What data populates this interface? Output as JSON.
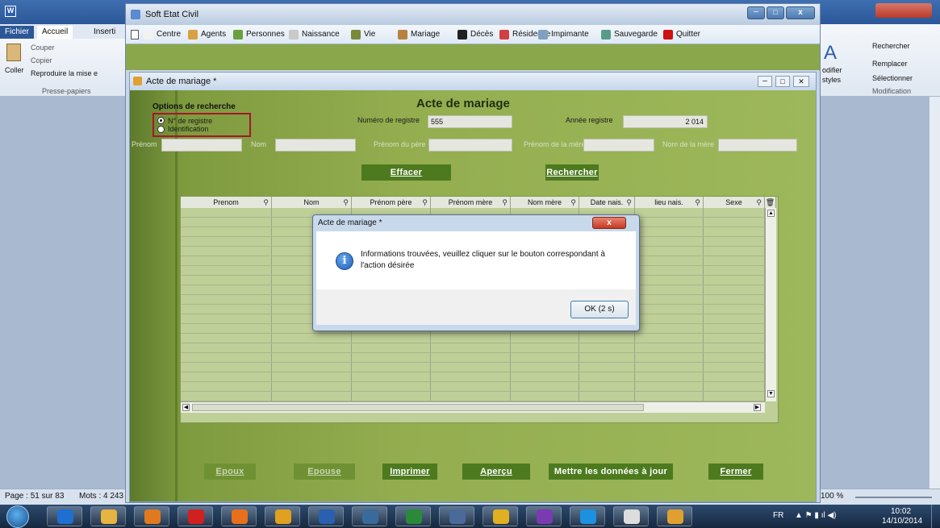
{
  "word": {
    "tabs": [
      "Fichier",
      "Accueil",
      "Inserti"
    ],
    "ribbon_left": {
      "couper": "Couper",
      "copier": "Copier",
      "coller": "Coller",
      "reproduire": "Reproduire la mise e",
      "group": "Presse-papiers"
    },
    "ribbon_right": {
      "modifier": "odifier",
      "styles": "styles",
      "rechercher": "Rechercher",
      "remplacer": "Remplacer",
      "selectionner": "Sélectionner",
      "group": "Modification"
    },
    "status": {
      "page": "Page : 51 sur 83",
      "mots": "Mots : 4 243",
      "zoom": "100 %"
    }
  },
  "app": {
    "title": "Soft Etat Civil",
    "menu": [
      "Centre",
      "Agents",
      "Personnes",
      "Naissance",
      "Vie",
      "Mariage",
      "Décès",
      "Résidence",
      "Impimante",
      "Sauvegarde",
      "Quitter"
    ],
    "menu_colors": [
      "#f2f2f2",
      "#d8a040",
      "#6aa03a",
      "#c9c9c9",
      "#7a8a3a",
      "#b8823e",
      "#222222",
      "#d04040",
      "#7fa0c0",
      "#5a9a8a",
      "#d01010"
    ]
  },
  "child": {
    "title": "Acte de mariage *",
    "form_title": "Acte de mariage",
    "options": {
      "title": "Options de recherche",
      "opt1": "N° de registre",
      "opt2": "Identification"
    },
    "num_registre": {
      "label": "Numéro de registre",
      "value": "555"
    },
    "annee": {
      "label": "Année registre",
      "value": "2 014"
    },
    "filters": {
      "prenom": "Prénom",
      "nom": "Nom",
      "pere": "Prénom du père",
      "mere": "Prénom de la mère",
      "nom_mere": "Nom de la mère"
    },
    "btn_effacer": "Effacer",
    "btn_rechercher": "Rechercher",
    "columns": [
      "Prenom",
      "Nom",
      "Prénom père",
      "Prénom mère",
      "Nom mère",
      "Date nais.",
      "lieu nais.",
      "Sexe"
    ],
    "bottom_buttons": [
      "Epoux",
      "Epouse",
      "Imprimer",
      "Aperçu",
      "Mettre les données à jour",
      "Fermer"
    ]
  },
  "dialog": {
    "title": "Acte de mariage *",
    "message": "Informations trouvées, veuillez cliquer sur le bouton correspondant à l'action désirée",
    "ok": "OK (2 s)",
    "close": "x"
  },
  "taskbar": {
    "lang": "FR",
    "time": "10:02",
    "date": "14/10/2014",
    "apps": [
      "ie",
      "explorer",
      "media",
      "opera",
      "firefox",
      "outlook",
      "word",
      "media2",
      "excel",
      "app",
      "chrome",
      "viber",
      "skype",
      "doc",
      "hf"
    ],
    "app_colors": [
      "#1e6fd0",
      "#e6b440",
      "#e07a20",
      "#d02020",
      "#e8701c",
      "#e0a020",
      "#2b5fb0",
      "#3a6a9a",
      "#2a8a3a",
      "#4a6a9a",
      "#e0b020",
      "#7a3ab0",
      "#1e90e0",
      "#dddddd",
      "#e0a030"
    ]
  }
}
